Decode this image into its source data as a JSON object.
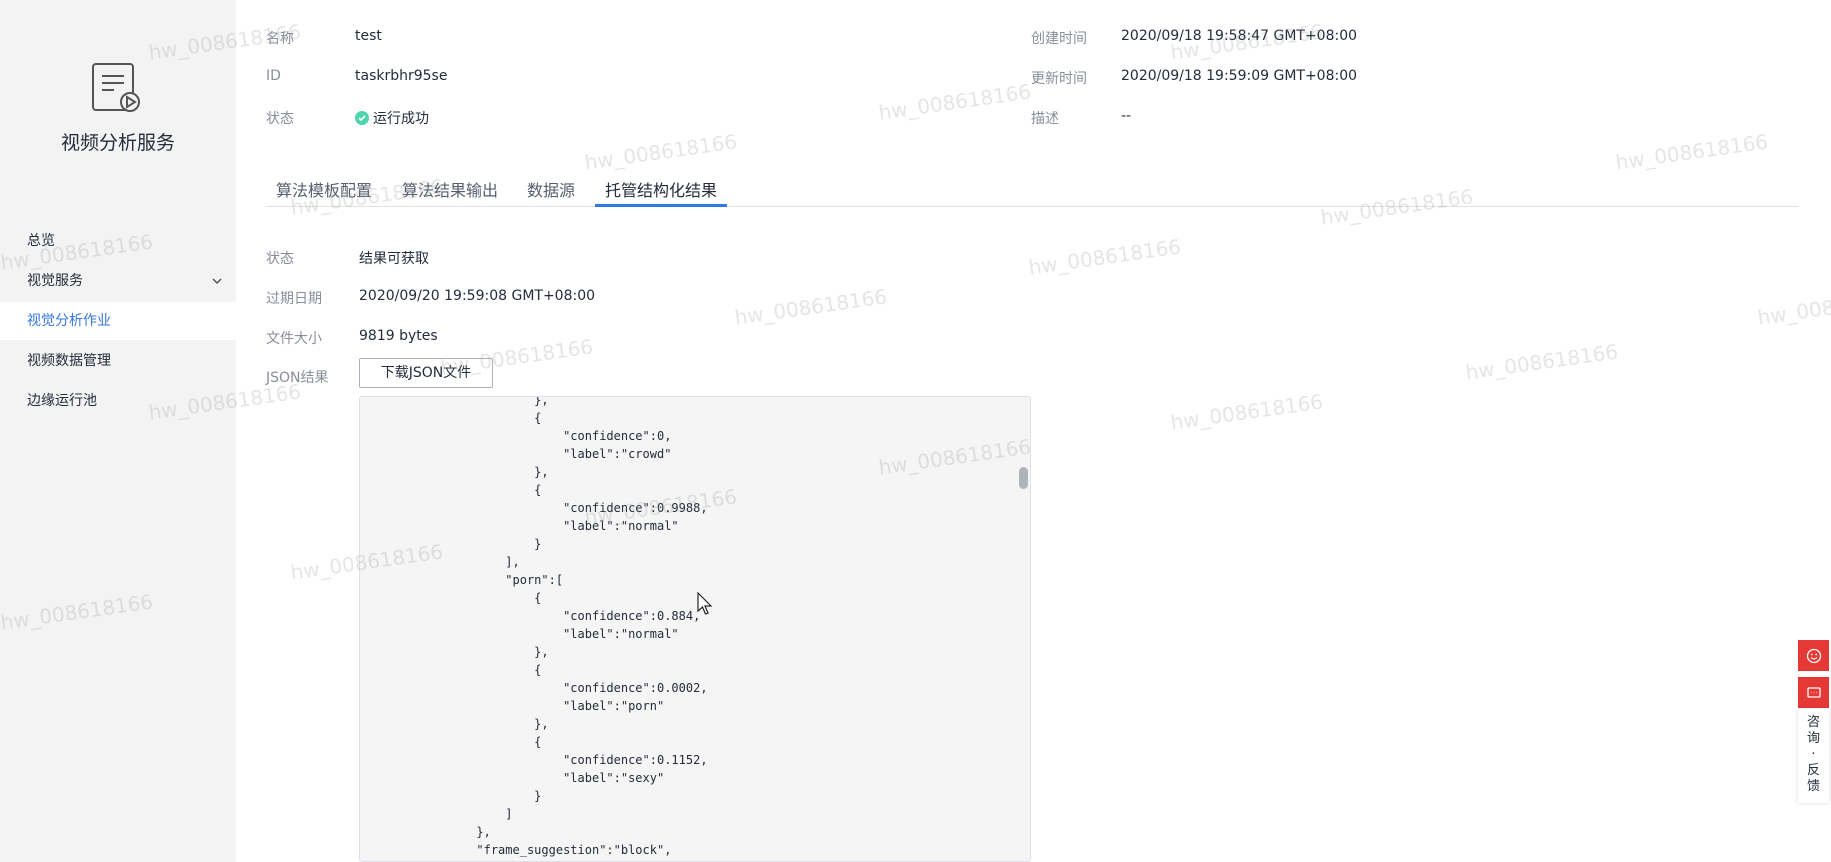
{
  "app": {
    "service_title": "视频分析服务"
  },
  "sidebar": {
    "items": [
      {
        "label": "总览"
      },
      {
        "label": "视觉服务"
      },
      {
        "label": "视觉分析作业"
      },
      {
        "label": "视频数据管理"
      },
      {
        "label": "边缘运行池"
      }
    ]
  },
  "info": {
    "name_label": "名称",
    "name_value": "test",
    "id_label": "ID",
    "id_value": "taskrbhr95se",
    "status_label": "状态",
    "status_value": "运行成功",
    "created_label": "创建时间",
    "created_value": "2020/09/18 19:58:47 GMT+08:00",
    "updated_label": "更新时间",
    "updated_value": "2020/09/18 19:59:09 GMT+08:00",
    "desc_label": "描述",
    "desc_value": "--"
  },
  "tabs": [
    {
      "label": "算法模板配置"
    },
    {
      "label": "算法结果输出"
    },
    {
      "label": "数据源"
    },
    {
      "label": "托管结构化结果"
    }
  ],
  "result": {
    "status_label": "状态",
    "status_value": "结果可获取",
    "expiry_label": "过期日期",
    "expiry_value": "2020/09/20 19:59:08 GMT+08:00",
    "size_label": "文件大小",
    "size_value": "9819 bytes",
    "json_label": "JSON结果",
    "download_button": "下载JSON文件",
    "json_text": "                       },\n                       {\n                           \"confidence\":0,\n                           \"label\":\"crowd\"\n                       },\n                       {\n                           \"confidence\":0.9988,\n                           \"label\":\"normal\"\n                       }\n                   ],\n                   \"porn\":[\n                       {\n                           \"confidence\":0.884,\n                           \"label\":\"normal\"\n                       },\n                       {\n                           \"confidence\":0.0002,\n                           \"label\":\"porn\"\n                       },\n                       {\n                           \"confidence\":0.1152,\n                           \"label\":\"sexy\"\n                       }\n                   ]\n               },\n               \"frame_suggestion\":\"block\",\n               \"scene_detail\":{"
  },
  "watermark": {
    "text": "hw_008618166"
  },
  "feedback": {
    "text": "咨询·反馈"
  },
  "colors": {
    "accent": "#3378e0",
    "success": "#50d4ab",
    "float_red": "#e53935"
  },
  "icons": [
    "service-logo-icon",
    "chevron-down-icon",
    "success-check-icon",
    "smile-icon",
    "chat-icon",
    "cursor-icon"
  ]
}
